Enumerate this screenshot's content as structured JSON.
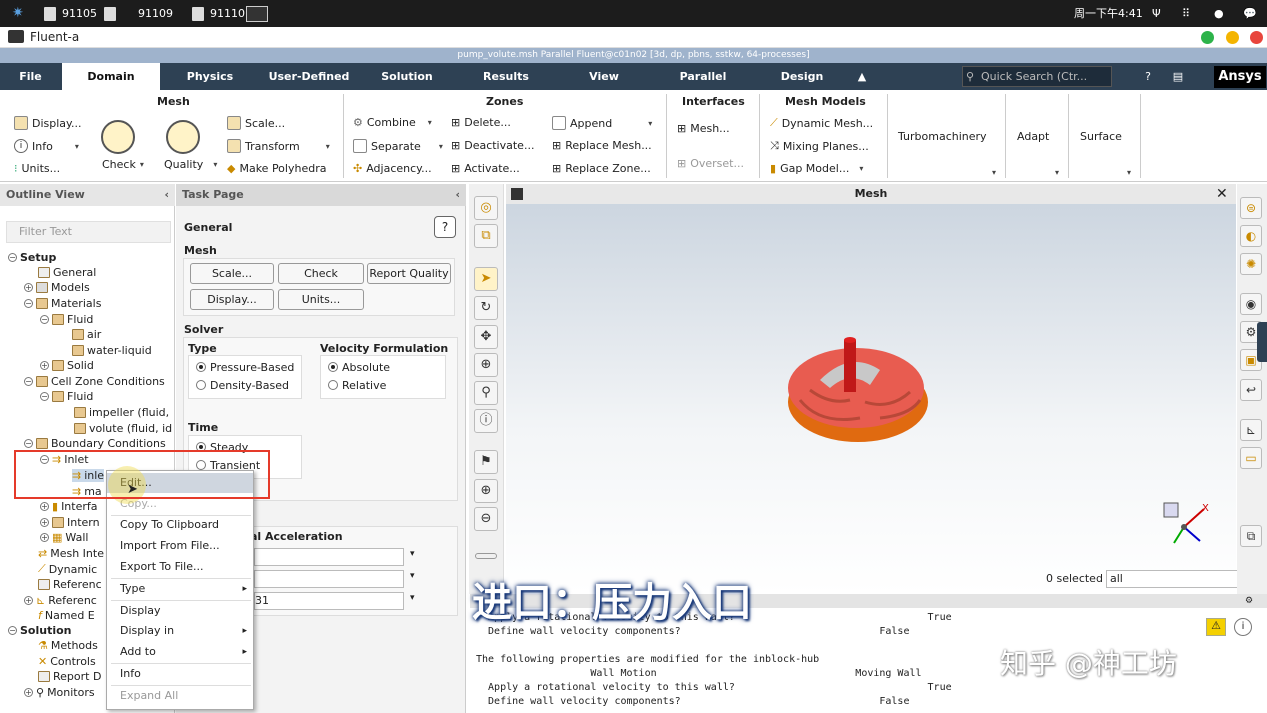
{
  "taskbar": {
    "items": [
      "91105",
      "91109",
      "91110"
    ],
    "clock": "周一下午4:41"
  },
  "window": {
    "title": "Fluent-a"
  },
  "fluent_title": "pump_volute.msh Parallel Fluent@c01n02  [3d, dp, pbns, sstkw, 64-processes]",
  "menu": {
    "file": "File",
    "domain": "Domain",
    "physics": "Physics",
    "user_defined": "User-Defined",
    "solution": "Solution",
    "results": "Results",
    "view": "View",
    "parallel": "Parallel",
    "design": "Design",
    "search_placeholder": "Quick Search (Ctr...",
    "brand": "Ansys"
  },
  "ribbon": {
    "mesh_group": "Mesh",
    "display": "Display...",
    "info": "Info",
    "units": "Units...",
    "check": "Check",
    "quality": "Quality",
    "scale": "Scale...",
    "transform": "Transform",
    "make_polyhedra": "Make Polyhedra",
    "zones_group": "Zones",
    "combine": "Combine",
    "separate": "Separate",
    "adjacency": "Adjacency...",
    "delete": "Delete...",
    "deactivate": "Deactivate...",
    "activate": "Activate...",
    "append": "Append",
    "replace_mesh": "Replace Mesh...",
    "replace_zone": "Replace Zone...",
    "interfaces_group": "Interfaces",
    "mesh_btn": "Mesh...",
    "overset": "Overset...",
    "mesh_models_group": "Mesh Models",
    "dynamic_mesh": "Dynamic Mesh...",
    "mixing_planes": "Mixing Planes...",
    "gap_model": "Gap Model...",
    "turbomachinery": "Turbomachinery",
    "adapt": "Adapt",
    "surface": "Surface"
  },
  "outline": {
    "header": "Outline View",
    "filter_placeholder": "Filter Text",
    "items": {
      "setup": "Setup",
      "general": "General",
      "models": "Models",
      "materials": "Materials",
      "fluid": "Fluid",
      "air": "air",
      "water_liquid": "water-liquid",
      "solid": "Solid",
      "cell_zone": "Cell Zone Conditions",
      "cz_fluid": "Fluid",
      "impeller": "impeller (fluid,",
      "volute": "volute (fluid, id",
      "boundary": "Boundary Conditions",
      "inlet": "Inlet",
      "inle": "inle",
      "ma": "ma",
      "interfa": "Interfa",
      "intern": "Intern",
      "wall": "Wall",
      "mesh_inte": "Mesh Inte",
      "dynamic": "Dynamic",
      "referenc1": "Referenc",
      "referenc2": "Referenc",
      "named_e": "Named E",
      "solution": "Solution",
      "methods": "Methods",
      "controls": "Controls",
      "report_d": "Report D",
      "monitors": "Monitors"
    }
  },
  "task": {
    "header": "Task Page",
    "title": "General",
    "mesh_label": "Mesh",
    "scale": "Scale...",
    "check": "Check",
    "report_quality": "Report Quality",
    "display": "Display...",
    "units": "Units...",
    "solver_label": "Solver",
    "type_label": "Type",
    "pressure_based": "Pressure-Based",
    "density_based": "Density-Based",
    "velocity_label": "Velocity Formulation",
    "absolute": "Absolute",
    "relative": "Relative",
    "time_label": "Time",
    "steady": "Steady",
    "transient": "Transient",
    "gravity_label": "al Acceleration",
    "field3_value": "31"
  },
  "context_menu": {
    "edit": "Edit...",
    "copy": "Copy...",
    "copy_clipboard": "Copy To Clipboard",
    "import": "Import From File...",
    "export": "Export To File...",
    "type": "Type",
    "display": "Display",
    "display_in": "Display in",
    "add_to": "Add to",
    "info": "Info",
    "expand_all": "Expand All"
  },
  "graphics": {
    "title": "Mesh",
    "selected": "0 selected",
    "filter": "all"
  },
  "console": {
    "line1": "  Apply a rotational velocity to this wall?                                True",
    "line2": "  Define wall velocity components?                                 False",
    "line3": "The following properties are modified for the inblock-hub",
    "line4": "                   Wall Motion                                 Moving Wall",
    "line5": "  Apply a rotational velocity to this wall?                                True",
    "line6": "  Define wall velocity components?                                 False"
  },
  "overlay": {
    "caption": "进口：压力入口",
    "watermark": "知乎 @神工坊"
  },
  "colors": {
    "menubar": "#2e4154",
    "accent": "#e53a2a",
    "impeller": "#e85c50"
  }
}
